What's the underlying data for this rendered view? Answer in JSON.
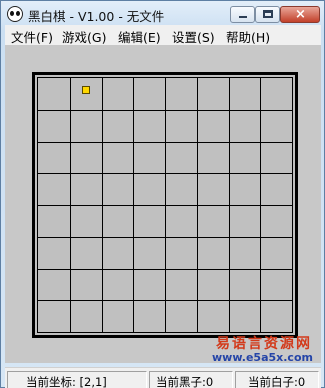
{
  "window": {
    "title": "黑白棋 - V1.00 - 无文件",
    "icon": "panda-icon"
  },
  "menu": [
    {
      "label": "文件(F)"
    },
    {
      "label": "游戏(G)"
    },
    {
      "label": "编辑(E)"
    },
    {
      "label": "设置(S)"
    },
    {
      "label": "帮助(H)"
    }
  ],
  "board": {
    "rows": 8,
    "cols": 8,
    "cursor": {
      "row": 1,
      "col": 2
    },
    "colors": {
      "cell": "#c0c0c0",
      "line": "#000000",
      "marker": "#ffd800"
    }
  },
  "status": {
    "coord": "当前坐标: [2,1]",
    "black": "当前黑子:0",
    "white": "当前白子:0"
  },
  "watermark": {
    "cn": "易语言资源网",
    "url": "www.e5a5x.com"
  }
}
